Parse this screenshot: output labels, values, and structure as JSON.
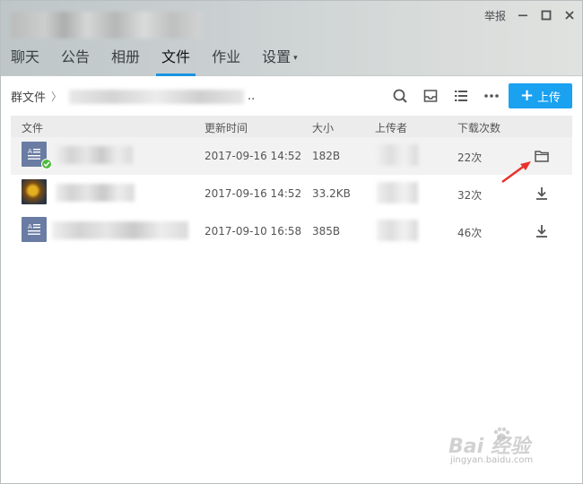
{
  "window": {
    "report_label": "举报",
    "controls": [
      "minimize-icon",
      "maximize-icon",
      "close-icon"
    ]
  },
  "tabs": [
    {
      "label": "聊天"
    },
    {
      "label": "公告"
    },
    {
      "label": "相册"
    },
    {
      "label": "文件",
      "active": true
    },
    {
      "label": "作业"
    },
    {
      "label": "设置",
      "caret": "▾"
    }
  ],
  "breadcrumb": {
    "root": "群文件",
    "separator": "〉",
    "current_suffix": ".."
  },
  "toolbar": {
    "icons": [
      "search-icon",
      "inbox-icon",
      "list-view-icon",
      "more-icon"
    ],
    "upload_label": "上传",
    "upload_plus": "+"
  },
  "table": {
    "headers": {
      "file": "文件",
      "updated": "更新时间",
      "size": "大小",
      "uploader": "上传者",
      "downloads": "下载次数"
    },
    "rows": [
      {
        "updated": "2017-09-16 14:52",
        "size": "182B",
        "downloads": "22次",
        "icon": "document-icon",
        "downloaded": true,
        "action_icon": "open-folder-icon"
      },
      {
        "updated": "2017-09-16 14:52",
        "size": "33.2KB",
        "downloads": "32次",
        "icon": "image-thumbnail",
        "downloaded": false,
        "action_icon": "download-icon"
      },
      {
        "updated": "2017-09-10 16:58",
        "size": "385B",
        "downloads": "46次",
        "icon": "document-icon",
        "downloaded": false,
        "action_icon": "download-icon"
      }
    ]
  },
  "watermark": {
    "main": "Bai 经验",
    "sub": "jingyan.baidu.com"
  },
  "colors": {
    "accent": "#1aa1f0",
    "tab_underline": "#1a95e0",
    "file_icon": "#6a7ca3",
    "check": "#4dbb3c",
    "annotation_arrow": "#e8312e"
  }
}
